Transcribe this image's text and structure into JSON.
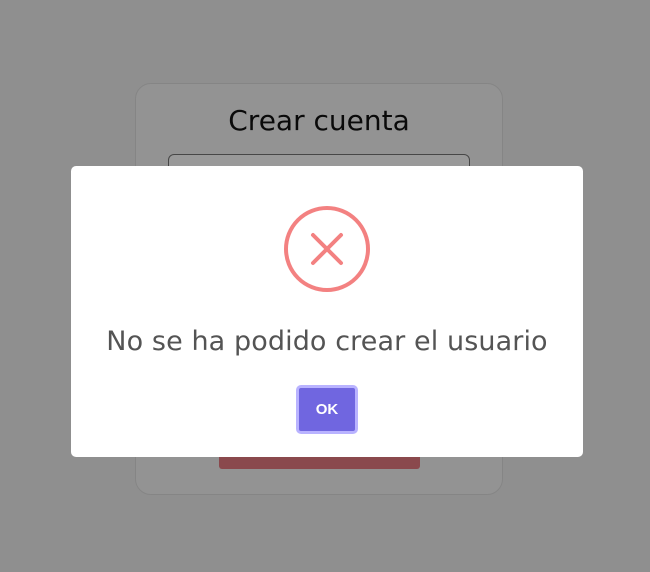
{
  "signup": {
    "title": "Crear cuenta"
  },
  "dialog": {
    "icon": "error-x-icon",
    "message": "No se ha podido crear el usuario",
    "confirm_label": "OK"
  },
  "colors": {
    "error": "#f27474",
    "confirm": "#7066e0",
    "submit": "#e77a80"
  }
}
